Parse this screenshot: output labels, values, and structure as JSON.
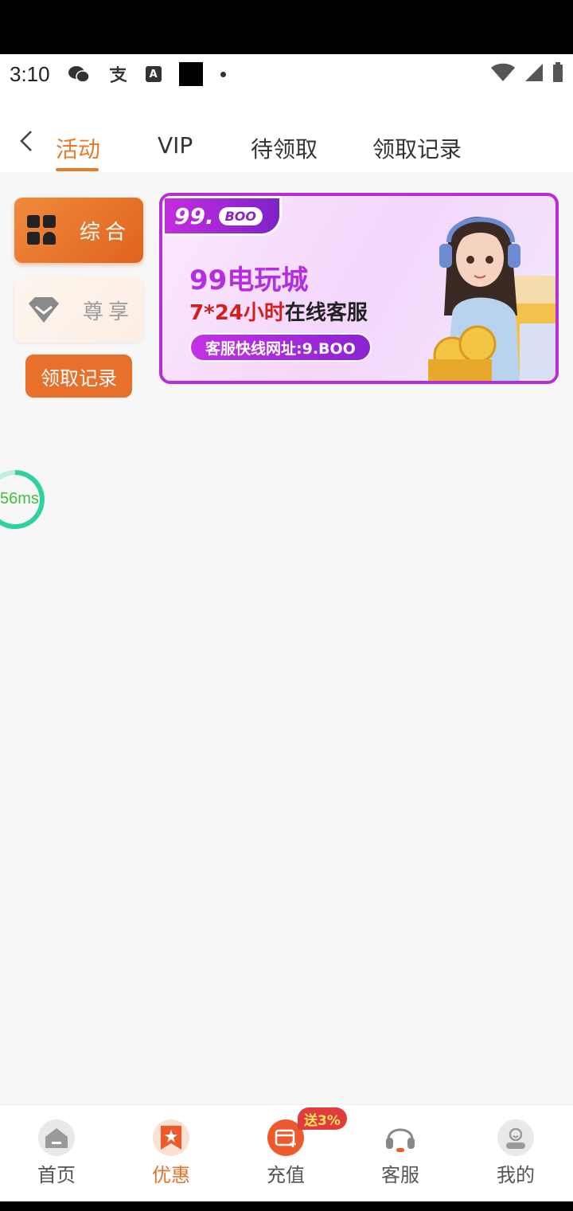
{
  "status_bar": {
    "time": "3:10",
    "icons": [
      "wechat-icon",
      "alipay-icon",
      "a-box-icon",
      "black-square-icon",
      "dot-icon"
    ],
    "right_icons": [
      "wifi-icon",
      "signal-icon",
      "battery-icon"
    ]
  },
  "nav": {
    "tabs": [
      {
        "label": "活动",
        "active": true
      },
      {
        "label": "VIP",
        "active": false
      },
      {
        "label": "待领取",
        "active": false
      },
      {
        "label": "领取记录",
        "active": false
      }
    ]
  },
  "sidebar": {
    "items": [
      {
        "label": "综合",
        "active": true,
        "icon": "grid-icon"
      },
      {
        "label": "尊享",
        "active": false,
        "icon": "diamond-icon"
      }
    ],
    "record_button": "领取记录"
  },
  "banner": {
    "badge_num": "99.",
    "badge_brand": "BOO",
    "title": "99电玩城",
    "sub_red": "7*24小时",
    "sub_black": "在线客服",
    "pill": "客服快线网址:9.BOO"
  },
  "ping": {
    "text": "56ms"
  },
  "bottom_nav": {
    "items": [
      {
        "label": "首页",
        "icon": "home-icon"
      },
      {
        "label": "优惠",
        "icon": "promo-icon",
        "active": true
      },
      {
        "label": "充值",
        "icon": "deposit-icon"
      },
      {
        "label": "客服",
        "icon": "headset-icon"
      },
      {
        "label": "我的",
        "icon": "profile-icon"
      }
    ],
    "promo_badge": "送3%"
  },
  "colors": {
    "accent": "#e8702a",
    "banner_border": "#b52fd6"
  }
}
